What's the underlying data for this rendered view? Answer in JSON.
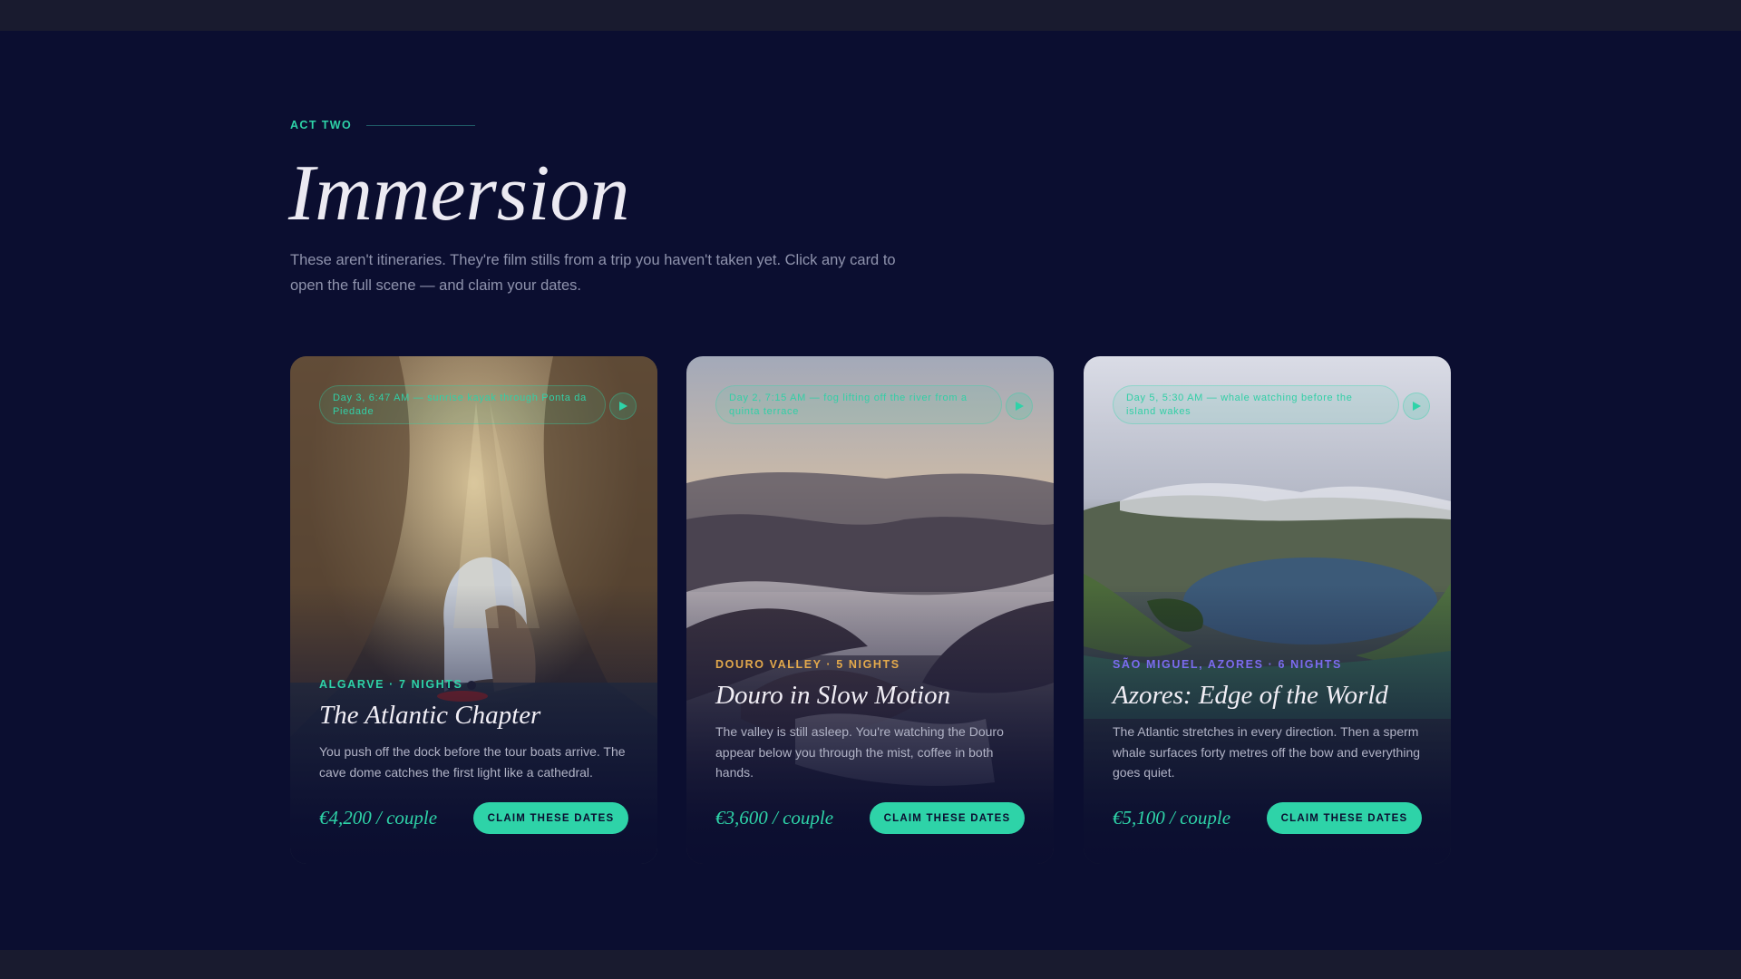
{
  "section": {
    "eyebrow": "ACT TWO",
    "title": "Immersion",
    "intro": "These aren't itineraries. They're film stills from a trip you haven't taken yet. Click any card to open the full scene — and claim your dates."
  },
  "colors": {
    "background": "#0b0e30",
    "accent": "#2ed3a8",
    "meta_algarve": "#2ed3a8",
    "meta_douro": "#e3a94c",
    "meta_azores": "#7b6cf0"
  },
  "cards": [
    {
      "scene": "Day 3, 6:47 AM — sunrise kayak through Ponta da Piedade",
      "play_icon": "play-icon",
      "meta": "ALGARVE · 7 NIGHTS",
      "title": "The Atlantic Chapter",
      "description": "You push off the dock before the tour boats arrive. The cave dome catches the first light like a cathedral.",
      "price": "€4,200 / couple",
      "cta": "CLAIM THESE DATES"
    },
    {
      "scene": "Day 2, 7:15 AM — fog lifting off the river from a quinta terrace",
      "play_icon": "play-icon",
      "meta": "DOURO VALLEY · 5 NIGHTS",
      "title": "Douro in Slow Motion",
      "description": "The valley is still asleep. You're watching the Douro appear below you through the mist, coffee in both hands.",
      "price": "€3,600 / couple",
      "cta": "CLAIM THESE DATES"
    },
    {
      "scene": "Day 5, 5:30 AM — whale watching before the island wakes",
      "play_icon": "play-icon",
      "meta": "SÃO MIGUEL, AZORES · 6 NIGHTS",
      "title": "Azores: Edge of the World",
      "description": "The Atlantic stretches in every direction. Then a sperm whale surfaces forty metres off the bow and everything goes quiet.",
      "price": "€5,100 / couple",
      "cta": "CLAIM THESE DATES"
    }
  ]
}
